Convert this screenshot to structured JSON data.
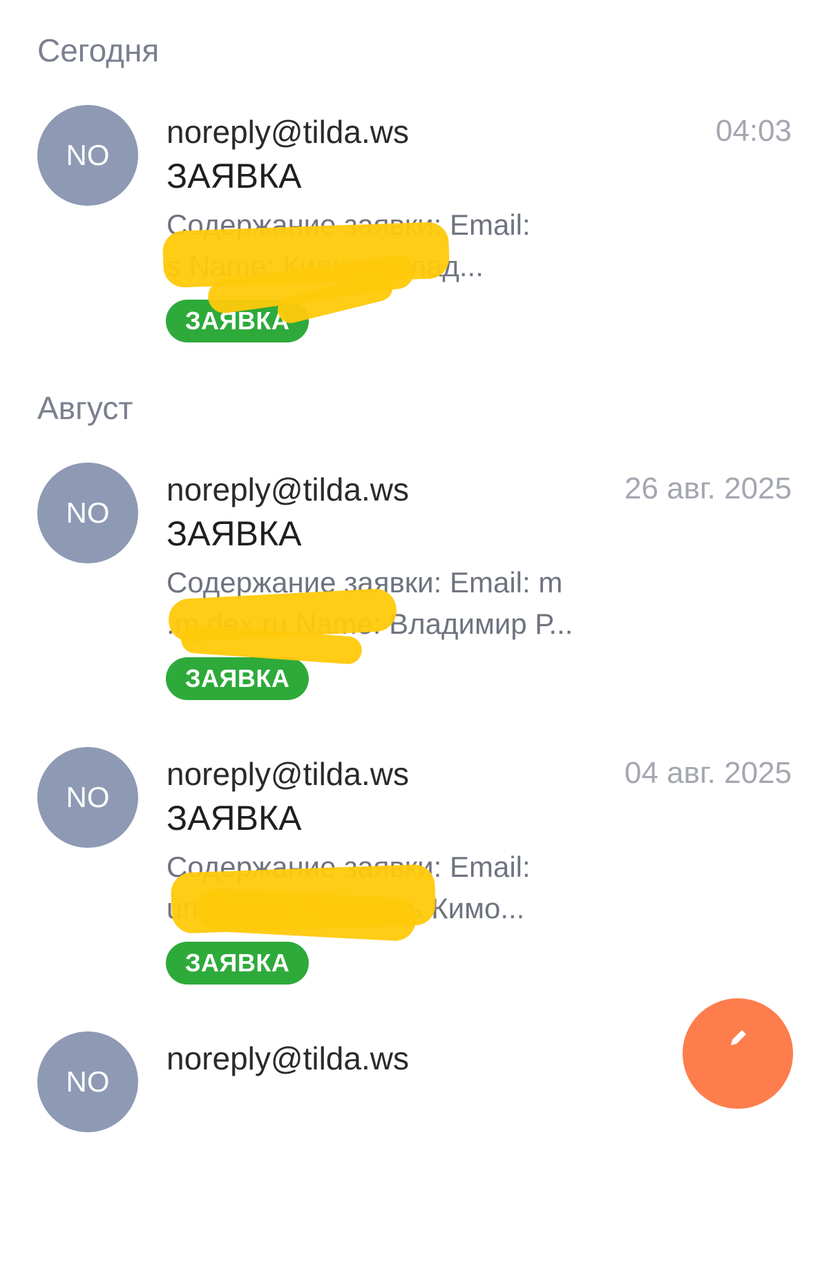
{
  "sections": [
    {
      "header": "Сегодня",
      "items": [
        {
          "avatar": "NO",
          "sender": "noreply@tilda.ws",
          "date": "04:03",
          "subject": "ЗАЯВКА",
          "snippet_line1": "Содержание заявки: Email:",
          "snippet_line2": "s                                 Name: Кирилл Влад...",
          "label": "ЗАЯВКА"
        }
      ]
    },
    {
      "header": "Август",
      "items": [
        {
          "avatar": "NO",
          "sender": "noreply@tilda.ws",
          "date": "26 авг. 2025",
          "subject": "ЗАЯВКА",
          "snippet_line1": "Содержание заявки: Email: m",
          "snippet_line2": ".m                   dex.ru Name: Владимир Р...",
          "label": "ЗАЯВКА"
        },
        {
          "avatar": "NO",
          "sender": "noreply@tilda.ws",
          "date": "04 авг. 2025",
          "subject": "ЗАЯВКА",
          "snippet_line1": "Содержание заявки: Email:",
          "snippet_line2": "un                           Name: Рафаиль Кимо...",
          "label": "ЗАЯВКА"
        },
        {
          "avatar": "NO",
          "sender": "noreply@tilda.ws"
        }
      ]
    }
  ],
  "colors": {
    "avatar_bg": "#8e99b4",
    "label_bg": "#2eaa3b",
    "fab_bg": "#fe7d4d",
    "redaction": "#ffc90a"
  },
  "fab_icon": "pencil-icon"
}
